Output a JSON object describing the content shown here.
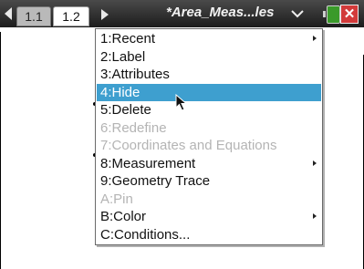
{
  "tabs": [
    {
      "label": "1.1"
    },
    {
      "label": "1.2"
    }
  ],
  "document": {
    "title": "*Area_Meas...les"
  },
  "menu": {
    "items": [
      {
        "label": "1:Recent",
        "enabled": true,
        "submenu": true,
        "selected": false
      },
      {
        "label": "2:Label",
        "enabled": true,
        "submenu": false,
        "selected": false
      },
      {
        "label": "3:Attributes",
        "enabled": true,
        "submenu": false,
        "selected": false
      },
      {
        "label": "4:Hide",
        "enabled": true,
        "submenu": false,
        "selected": true
      },
      {
        "label": "5:Delete",
        "enabled": true,
        "submenu": false,
        "selected": false
      },
      {
        "label": "6:Redefine",
        "enabled": false,
        "submenu": false,
        "selected": false
      },
      {
        "label": "7:Coordinates and Equations",
        "enabled": false,
        "submenu": false,
        "selected": false
      },
      {
        "label": "8:Measurement",
        "enabled": true,
        "submenu": true,
        "selected": false
      },
      {
        "label": "9:Geometry Trace",
        "enabled": true,
        "submenu": false,
        "selected": false
      },
      {
        "label": "A:Pin",
        "enabled": false,
        "submenu": false,
        "selected": false
      },
      {
        "label": "B:Color",
        "enabled": true,
        "submenu": true,
        "selected": false
      },
      {
        "label": "C:Conditions...",
        "enabled": true,
        "submenu": false,
        "selected": false
      }
    ]
  },
  "colors": {
    "selected_bg": "#3e9fcf",
    "disabled_text": "#b4b4b4",
    "titlebar_bg": "#1c1c1c",
    "battery": "#3a9a2a",
    "close": "#d23a3a"
  },
  "icons": [
    "tab-left-arrow-icon",
    "tab-right-arrow-icon",
    "chevron-down-icon",
    "battery-icon",
    "close-icon",
    "submenu-arrow-icon",
    "pointer-cursor-icon"
  ]
}
